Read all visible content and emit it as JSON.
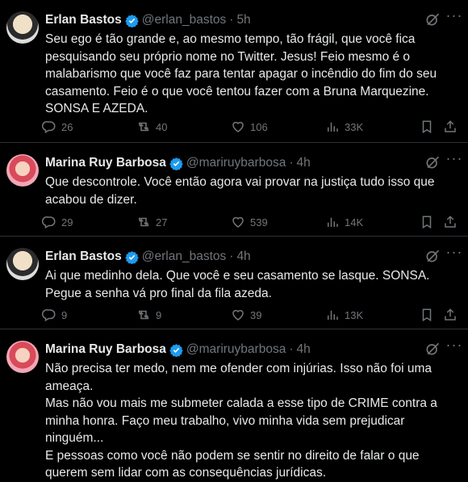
{
  "tweets": [
    {
      "name": "Erlan Bastos",
      "handle": "@erlan_bastos",
      "dot": "·",
      "time": "5h",
      "avatar": "erlan",
      "paragraphs": [
        "Seu ego é tão grande e, ao mesmo tempo, tão frágil, que você fica pesquisando seu próprio nome no Twitter. Jesus! Feio mesmo é o malabarismo que você faz para tentar apagar o incêndio do fim do seu casamento. Feio é o que você tentou fazer com a Bruna Marquezine. SONSA E AZEDA."
      ],
      "replies": "26",
      "retweets": "40",
      "likes": "106",
      "views": "33K"
    },
    {
      "name": "Marina Ruy Barbosa",
      "handle": "@mariruybarbosa",
      "dot": "·",
      "time": "4h",
      "avatar": "marina",
      "paragraphs": [
        "Que descontrole. Você então agora vai provar na justiça tudo isso que acabou de dizer."
      ],
      "replies": "29",
      "retweets": "27",
      "likes": "539",
      "views": "14K"
    },
    {
      "name": "Erlan Bastos",
      "handle": "@erlan_bastos",
      "dot": "·",
      "time": "4h",
      "avatar": "erlan",
      "paragraphs": [
        "Ai que medinho dela. Que você e seu casamento se lasque. SONSA. Pegue a senha vá pro final da fila azeda."
      ],
      "replies": "9",
      "retweets": "9",
      "likes": "39",
      "views": "13K"
    },
    {
      "name": "Marina Ruy Barbosa",
      "handle": "@mariruybarbosa",
      "dot": "·",
      "time": "4h",
      "avatar": "marina",
      "paragraphs": [
        "Não precisa ter medo, nem me ofender com injúrias. Isso não foi uma ameaça.",
        "Mas não vou mais me submeter calada a esse tipo de CRIME contra a minha honra. Faço meu trabalho, vivo minha vida sem prejudicar ninguém...",
        "E pessoas como você não podem se sentir no direito de falar o que querem sem lidar com as consequências jurídicas."
      ]
    }
  ],
  "icons": {
    "verified": "verified-badge-icon",
    "grok": "grok-icon",
    "more": "more-icon",
    "reply": "reply-icon",
    "retweet": "retweet-icon",
    "like": "like-icon",
    "views": "views-icon",
    "bookmark": "bookmark-icon",
    "share": "share-icon"
  },
  "colors": {
    "background": "#000000",
    "text": "#e7e9ea",
    "muted": "#71767b",
    "verified": "#1d9bf0"
  }
}
